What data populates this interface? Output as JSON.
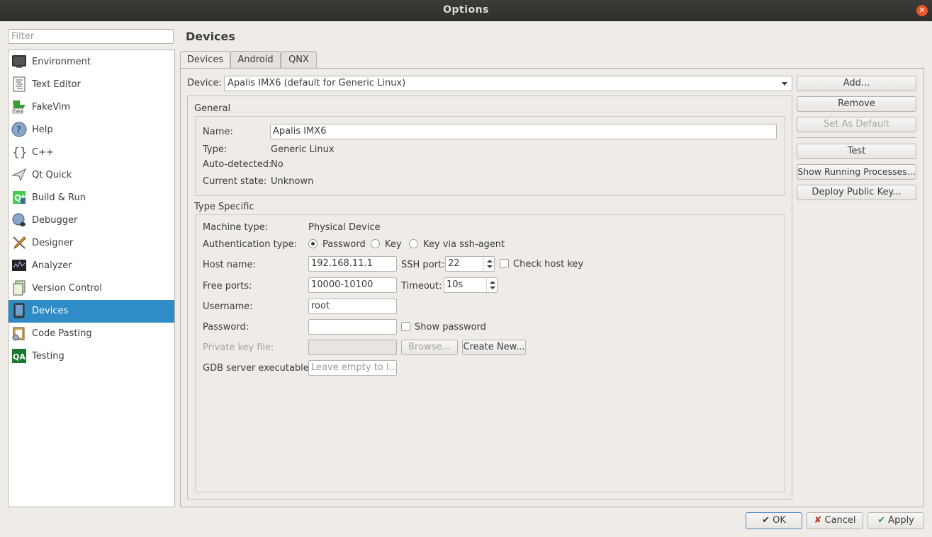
{
  "window": {
    "title": "Options",
    "close_glyph": "✕"
  },
  "filter": {
    "placeholder": "Filter"
  },
  "sidebar": {
    "items": [
      {
        "label": "Environment",
        "icon": "monitor-icon"
      },
      {
        "label": "Text Editor",
        "icon": "text-document-icon"
      },
      {
        "label": "FakeVim",
        "icon": "fakevim-icon"
      },
      {
        "label": "Help",
        "icon": "help-icon"
      },
      {
        "label": "C++",
        "icon": "braces-icon"
      },
      {
        "label": "Qt Quick",
        "icon": "paper-plane-icon"
      },
      {
        "label": "Build & Run",
        "icon": "qt-build-icon"
      },
      {
        "label": "Debugger",
        "icon": "bug-icon"
      },
      {
        "label": "Designer",
        "icon": "brush-icon"
      },
      {
        "label": "Analyzer",
        "icon": "analyzer-icon"
      },
      {
        "label": "Version Control",
        "icon": "version-control-icon"
      },
      {
        "label": "Devices",
        "icon": "device-icon",
        "selected": true
      },
      {
        "label": "Code Pasting",
        "icon": "clipboard-icon"
      },
      {
        "label": "Testing",
        "icon": "qa-icon"
      }
    ],
    "selection_color": "#308cc6"
  },
  "main": {
    "heading": "Devices",
    "tabs": [
      "Devices",
      "Android",
      "QNX"
    ],
    "device_label": "Device:",
    "device_value": "Apalis IMX6 (default for Generic Linux)",
    "buttons": {
      "add": "Add...",
      "remove": "Remove",
      "set_default": "Set As Default",
      "test": "Test",
      "show_processes": "Show Running Processes...",
      "deploy_key": "Deploy Public Key..."
    },
    "general": {
      "title": "General",
      "name_label": "Name:",
      "name_value": "Apalis IMX6",
      "type_label": "Type:",
      "type_value": "Generic Linux",
      "auto_label": "Auto-detected:",
      "auto_value": "No",
      "state_label": "Current state:",
      "state_value": "Unknown"
    },
    "type_specific": {
      "title": "Type Specific",
      "machine_label": "Machine type:",
      "machine_value": "Physical Device",
      "auth_label": "Authentication type:",
      "auth_options": [
        "Password",
        "Key",
        "Key via ssh-agent"
      ],
      "host_label": "Host name:",
      "host_value": "192.168.11.1",
      "ssh_label": "SSH port:",
      "ssh_value": "22",
      "check_host_label": "Check host key",
      "ports_label": "Free ports:",
      "ports_value": "10000-10100",
      "timeout_label": "Timeout:",
      "timeout_value": "10s",
      "user_label": "Username:",
      "user_value": "root",
      "password_label": "Password:",
      "password_value": "",
      "show_password_label": "Show password",
      "keyfile_label": "Private key file:",
      "browse_label": "Browse...",
      "create_label": "Create New...",
      "gdb_label": "GDB server executable:",
      "gdb_placeholder": "Leave empty to l..."
    }
  },
  "footer": {
    "ok": "OK",
    "cancel": "Cancel",
    "apply": "Apply"
  }
}
